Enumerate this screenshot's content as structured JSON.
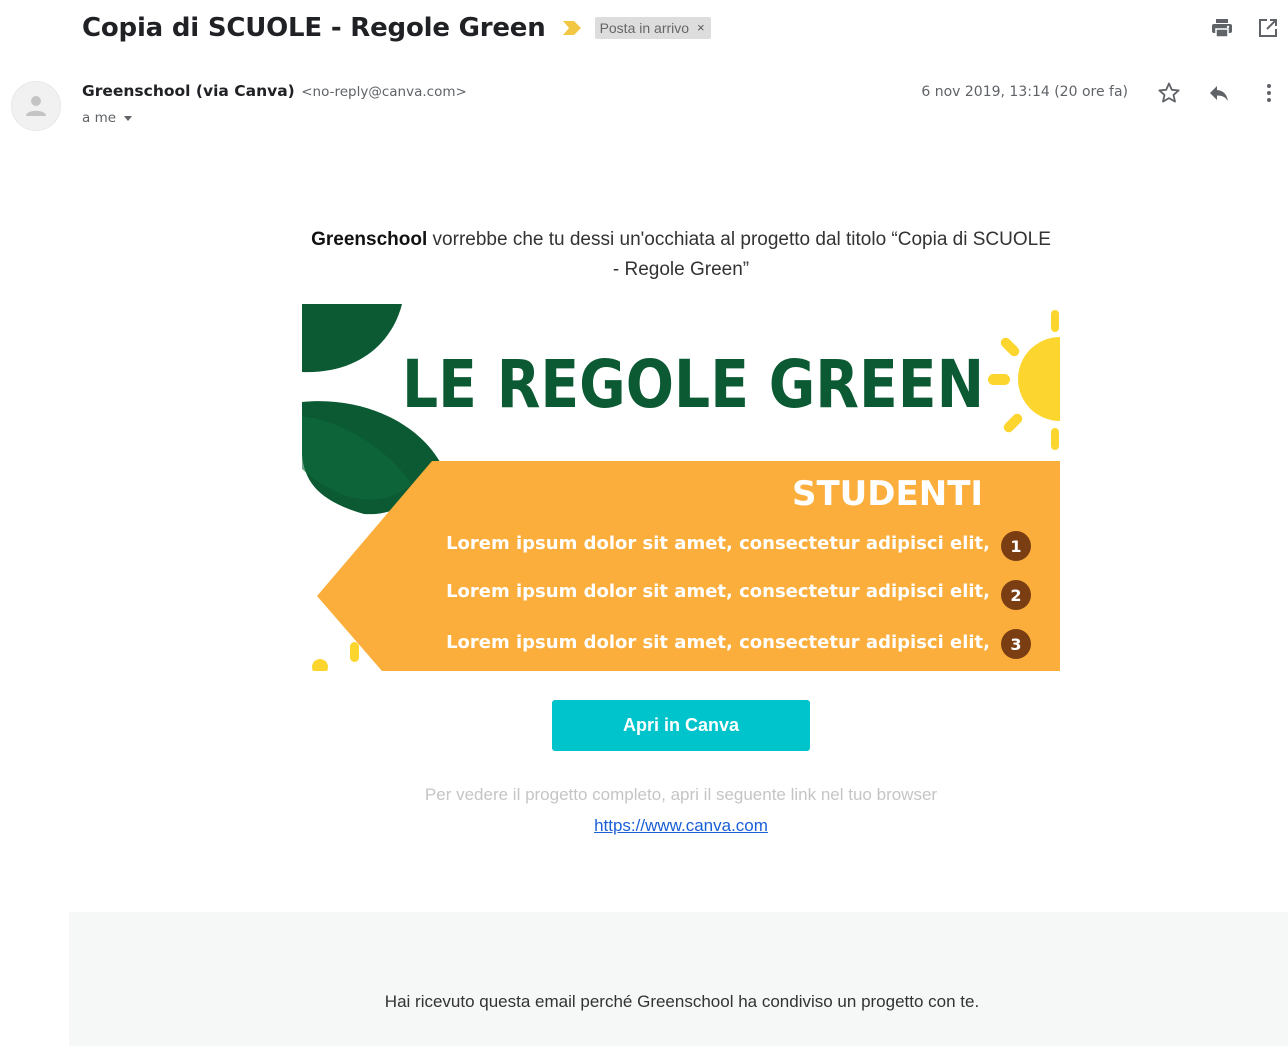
{
  "email": {
    "subject": "Copia di SCUOLE - Regole Green",
    "label": "Posta in arrivo",
    "label_remove": "×",
    "sender_name": "Greenschool (via Canva)",
    "sender_email": "<no-reply@canva.com>",
    "recipient": "a me",
    "date": "6 nov 2019, 13:14 (20 ore fa)"
  },
  "body": {
    "intro_name": "Greenschool",
    "intro_text": " vorrebbe che tu dessi un'occhiata al progetto dal titolo “Copia di SCUOLE - Regole Green”",
    "banner": {
      "title": "LE REGOLE GREEN",
      "subtitle": "STUDENTI",
      "rules": [
        {
          "text": "Lorem ipsum dolor sit amet, consectetur adipisci elit,",
          "num": "1"
        },
        {
          "text": "Lorem ipsum dolor sit amet, consectetur adipisci elit,",
          "num": "2"
        },
        {
          "text": "Lorem ipsum dolor sit amet, consectetur adipisci elit,",
          "num": "3"
        }
      ]
    },
    "open_button": "Apri in Canva",
    "hint": "Per vedere il progetto completo, apri il seguente link nel tuo browser",
    "link": "https://www.canva.com"
  },
  "footer": {
    "text": "Hai ricevuto questa email perché Greenschool ha condiviso un progetto con te."
  },
  "colors": {
    "canva_button": "#00c4cc",
    "banner_green": "#0b5a33",
    "banner_orange": "#fbae3c",
    "banner_yellow": "#fcd62f",
    "number_badge": "#7a3e12",
    "importance_marker": "#f2c744"
  },
  "icons": {
    "importance": "importance-marker-icon",
    "print": "print-icon",
    "open_new_window": "open-in-new-window-icon",
    "avatar": "person-avatar-icon",
    "star": "star-icon",
    "reply": "reply-icon",
    "more": "more-vertical-icon"
  }
}
